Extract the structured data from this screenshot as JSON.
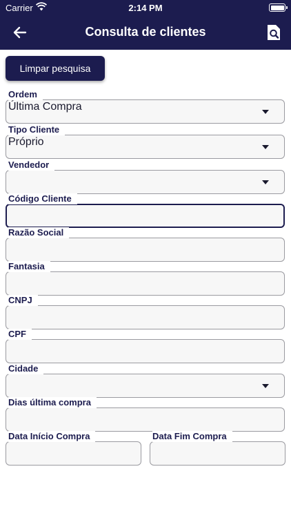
{
  "status_bar": {
    "carrier": "Carrier",
    "time": "2:14 PM"
  },
  "header": {
    "title": "Consulta de clientes",
    "back_icon": "arrow-left-icon",
    "action_icon": "document-search-icon"
  },
  "actions": {
    "clear_label": "Limpar pesquisa"
  },
  "fields": {
    "ordem": {
      "label": "Ordem",
      "value": "Última Compra"
    },
    "tipo_cliente": {
      "label": "Tipo Cliente",
      "value": "Próprio"
    },
    "vendedor": {
      "label": "Vendedor",
      "value": ""
    },
    "codigo_cliente": {
      "label": "Código Cliente",
      "value": ""
    },
    "razao_social": {
      "label": "Razão Social",
      "value": ""
    },
    "fantasia": {
      "label": "Fantasia",
      "value": ""
    },
    "cnpj": {
      "label": "CNPJ",
      "value": ""
    },
    "cpf": {
      "label": "CPF",
      "value": ""
    },
    "cidade": {
      "label": "Cidade",
      "value": ""
    },
    "dias_ultima_compra": {
      "label": "Dias última compra",
      "value": ""
    },
    "data_inicio_compra": {
      "label": "Data Início Compra",
      "value": ""
    },
    "data_fim_compra": {
      "label": "Data Fim Compra",
      "value": ""
    }
  },
  "colors": {
    "primary": "#1c1c4f",
    "field_bg": "#f7f7f7",
    "border": "#9a9aa0"
  }
}
